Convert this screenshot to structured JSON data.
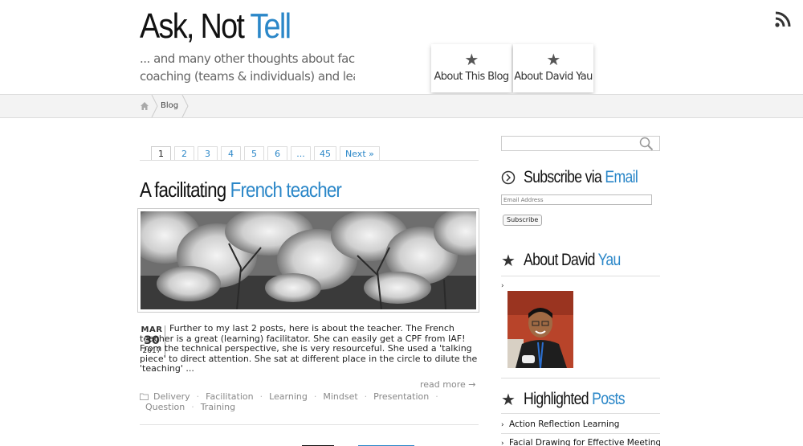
{
  "header": {
    "title_part1": "Ask, Not",
    "title_part2": "Tell",
    "tagline_line1": "... and many other thoughts about facilitation,",
    "tagline_line2": "coaching (teams & individuals) and learning",
    "nav": [
      {
        "label": "About This Blog",
        "icon": "star-icon"
      },
      {
        "label": "About David Yau",
        "icon": "star-icon"
      }
    ],
    "rss_icon": "rss-icon"
  },
  "breadcrumb": {
    "home_icon": "home-icon",
    "current": "Blog"
  },
  "pagination": {
    "pages": [
      "1",
      "2",
      "3",
      "4",
      "5",
      "6",
      "...",
      "45"
    ],
    "current": "1",
    "next_label": "Next »"
  },
  "post": {
    "title_part1": "A facilitating",
    "title_part2": "French teacher",
    "date_month": "MAR",
    "date_day": "30",
    "date_year": "2017",
    "excerpt": "Further to my last 2 posts, here is about the teacher.   The French teacher is a great (learning) facilitator.   She can easily get a CPF from IAF! From the technical perspective, she is very resourceful.   She used a 'talking piece' to direct attention.   She sat at different place in the circle to dilute the 'teaching' ...",
    "read_more": "read more →",
    "tags": [
      "Delivery",
      "Facilitation",
      "Learning",
      "Mindset",
      "Presentation",
      "Question",
      "Training"
    ]
  },
  "sidebar": {
    "search_icon": "search-icon",
    "subscribe": {
      "title_part1": "Subscribe via",
      "title_part2": "Email",
      "email_placeholder": "Email Address",
      "button_label": "Subscribe"
    },
    "about": {
      "title_part1": "About David",
      "title_part2": "Yau",
      "link_glyph": "›"
    },
    "highlighted": {
      "title_part1": "Highlighted",
      "title_part2": "Posts",
      "items": [
        "Action Reflection Learning",
        "Facial Drawing for Effective Meeting"
      ]
    }
  },
  "colors": {
    "accent": "#2b87c8",
    "text": "#111111",
    "breadcrumb_bg": "#f3f3f3"
  }
}
